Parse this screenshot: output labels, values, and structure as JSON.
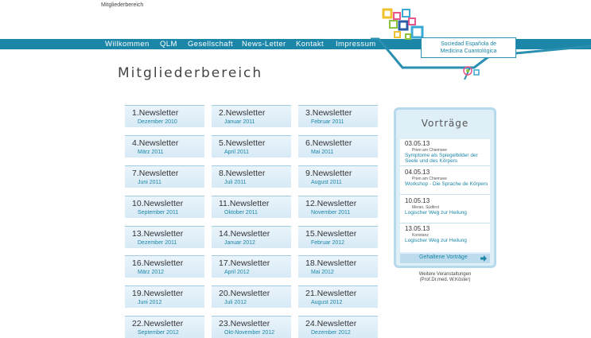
{
  "header": {
    "title": "Mitgliederbereich"
  },
  "nav": [
    {
      "label": "Willkommen"
    },
    {
      "label": "QLM"
    },
    {
      "label": "Gesellschaft"
    },
    {
      "label": "News-Letter"
    },
    {
      "label": "Kontakt"
    },
    {
      "label": "Impressum"
    }
  ],
  "logo": {
    "line1": "Sociedad Española de",
    "line2": "Medicina Cuantológica",
    "colors": [
      "#f2c12e",
      "#e8548c",
      "#3aa9d6",
      "#8cc43f",
      "#2a5da8"
    ]
  },
  "page_title": "Mitgliederbereich",
  "newsletters": [
    {
      "title": "1.Newsletter",
      "date": "Dezember 2010"
    },
    {
      "title": "2.Newsletter",
      "date": "Januar 2011"
    },
    {
      "title": "3.Newsletter",
      "date": "Februar 2011"
    },
    {
      "title": "4.Newsletter",
      "date": "März 2011"
    },
    {
      "title": "5.Newsletter",
      "date": "April 2011"
    },
    {
      "title": "6.Newsletter",
      "date": "Mai 2011"
    },
    {
      "title": "7.Newsletter",
      "date": "Juni 2011"
    },
    {
      "title": "8.Newsletter",
      "date": "Juli 2011"
    },
    {
      "title": "9.Newsletter",
      "date": "August 2011"
    },
    {
      "title": "10.Newsletter",
      "date": "September 2011"
    },
    {
      "title": "11.Newsletter",
      "date": "Oktober 2011"
    },
    {
      "title": "12.Newsletter",
      "date": "November 2011"
    },
    {
      "title": "13.Newsletter",
      "date": "Dezember 2011"
    },
    {
      "title": "14.Newsletter",
      "date": "Januar 2012"
    },
    {
      "title": "15.Newsletter",
      "date": "Februar 2012"
    },
    {
      "title": "16.Newsletter",
      "date": "März 2012"
    },
    {
      "title": "17.Newsletter",
      "date": "April 2012"
    },
    {
      "title": "18.Newsletter",
      "date": "Mai 2012"
    },
    {
      "title": "19.Newsletter",
      "date": "Juni 2012"
    },
    {
      "title": "20.Newsletter",
      "date": "Juli 2012"
    },
    {
      "title": "21.Newsletter",
      "date": "August 2012"
    },
    {
      "title": "22.Newsletter",
      "date": "September 2012"
    },
    {
      "title": "23.Newsletter",
      "date": "Okt-November 2012"
    },
    {
      "title": "24.Newsletter",
      "date": "Dezember 2012"
    }
  ],
  "vortraege": {
    "heading": "Vorträge",
    "items": [
      {
        "date": "03.05.13",
        "place": "Prien am Chiemsee",
        "text": "Symptome als Spiegelbilder der Seele und des Körpers"
      },
      {
        "date": "04.05.13",
        "place": "Prien am Chiemsee",
        "text": "Workshop - Die Sprache de Körpers"
      },
      {
        "date": "10.05.13",
        "place": "Meran, Südtirol",
        "text": "Logischer Weg zur Heilung"
      },
      {
        "date": "13.05.13",
        "place": "Konstanz",
        "text": "Logischer Weg zur Heilung"
      }
    ],
    "button_label": "Gehaltene Vorträge",
    "footer_line1": "Weitere Veranstaltungen",
    "footer_line2": "(Prof.Dr.med. W.Köster)"
  }
}
